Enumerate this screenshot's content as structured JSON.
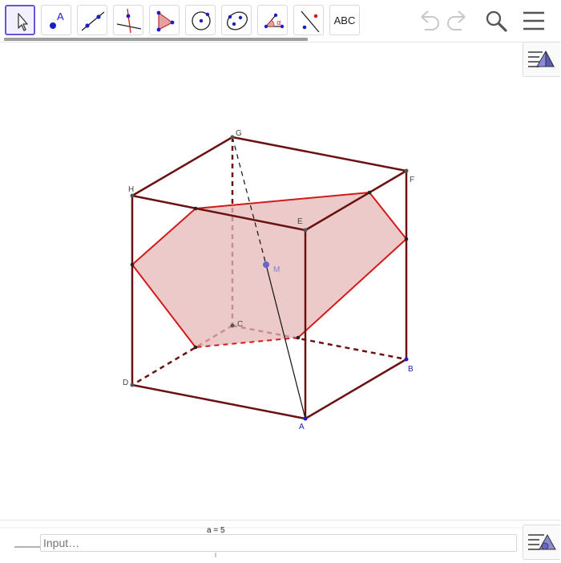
{
  "toolbar": {
    "tools": [
      {
        "id": "move",
        "icon": "move-cursor-icon"
      },
      {
        "id": "point",
        "icon": "point-tool-icon",
        "label": "A"
      },
      {
        "id": "line",
        "icon": "line-tool-icon"
      },
      {
        "id": "perpendicular",
        "icon": "perpendicular-line-icon"
      },
      {
        "id": "polygon",
        "icon": "polygon-tool-icon"
      },
      {
        "id": "circle",
        "icon": "circle-tool-icon"
      },
      {
        "id": "ellipse",
        "icon": "ellipse-tool-icon"
      },
      {
        "id": "angle",
        "icon": "angle-tool-icon",
        "label": "α"
      },
      {
        "id": "reflect",
        "icon": "reflect-tool-icon"
      },
      {
        "id": "text",
        "icon": "text-tool-icon",
        "label": "ABC"
      }
    ],
    "undo_icon": "undo-icon",
    "redo_icon": "redo-icon",
    "search_icon": "search-icon",
    "menu_icon": "menu-icon"
  },
  "graphics": {
    "points": {
      "A": {
        "label": "A"
      },
      "B": {
        "label": "B"
      },
      "C": {
        "label": "C"
      },
      "D": {
        "label": "D"
      },
      "E": {
        "label": "E"
      },
      "F": {
        "label": "F"
      },
      "G": {
        "label": "G"
      },
      "H": {
        "label": "H"
      },
      "M": {
        "label": "M"
      }
    },
    "colors": {
      "edge": "#6b1111",
      "section_fill": "#e6b8b8",
      "section_stroke": "#d11b1b",
      "segment": "#111111",
      "point_blue": "#1d1dc7",
      "point_dark": "#333333",
      "point_m": "#6666cc",
      "label_blue": "#1a1ab0",
      "label_dark": "#444444",
      "label_m": "#8080e0"
    }
  },
  "algebra": {
    "value": "a = 5",
    "input_placeholder": "Input…"
  }
}
